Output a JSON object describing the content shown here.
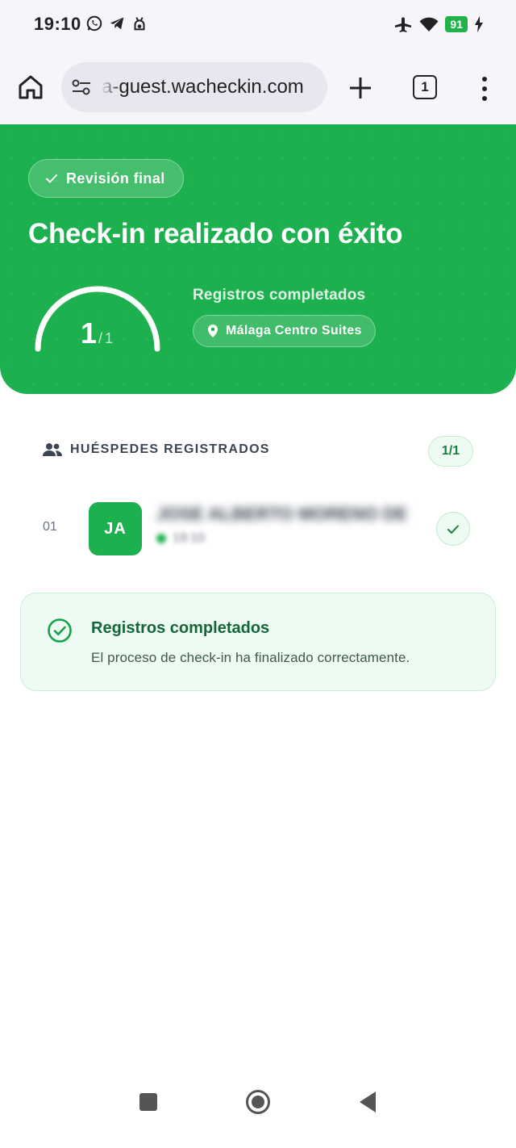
{
  "status_bar": {
    "time": "19:10",
    "left_icons": [
      "whatsapp-icon",
      "telegram-icon",
      "android-icon"
    ],
    "right_icons": [
      "airplane-icon",
      "wifi-icon",
      "battery-icon",
      "charging-icon"
    ],
    "battery_level": "91"
  },
  "browser": {
    "url": "a-guest.wacheckin.com",
    "tab_count": "1"
  },
  "hero": {
    "step_label": "Revisión final",
    "title": "Check-in realizado con éxito",
    "completed": "1",
    "separator": "/",
    "total": "1",
    "progress_fraction": 1.0,
    "subtitle": "Registros completados",
    "location": "Málaga Centro Suites"
  },
  "guests": {
    "section_title": "HUÉSPEDES REGISTRADOS",
    "count_badge": "1/1",
    "items": [
      {
        "number": "01",
        "initials": "JA",
        "name": "JOSE ALBERTO MORENO DE LA",
        "time": "19:10"
      }
    ]
  },
  "summary_card": {
    "title": "Registros completados",
    "text": "El proceso de check-in ha finalizado correctamente."
  },
  "colors": {
    "brand_green": "#1db04e",
    "card_bg": "#edfbf2",
    "dark_green_text": "#16663a"
  }
}
